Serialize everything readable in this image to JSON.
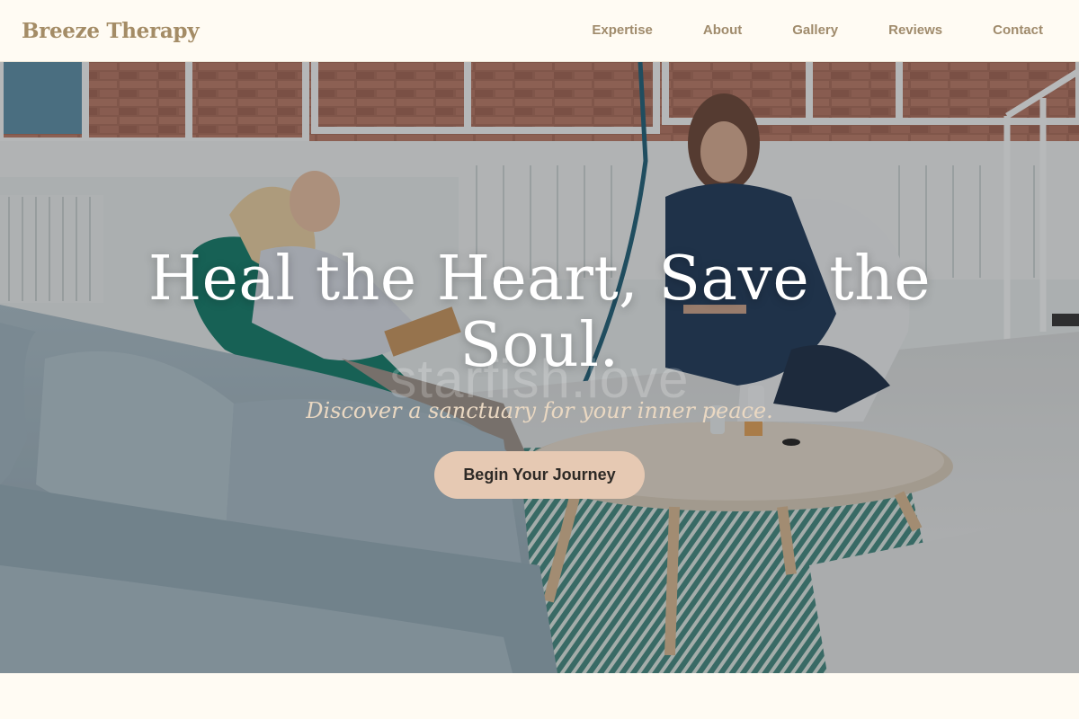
{
  "brand": {
    "name": "Breeze Therapy"
  },
  "nav": {
    "items": [
      {
        "label": "Expertise"
      },
      {
        "label": "About"
      },
      {
        "label": "Gallery"
      },
      {
        "label": "Reviews"
      },
      {
        "label": "Contact"
      }
    ]
  },
  "hero": {
    "headline": "Heal the Heart, Save the Soul.",
    "watermark": "starfish.love",
    "tagline": "Discover a sanctuary for your inner peace.",
    "cta_label": "Begin Your Journey"
  },
  "colors": {
    "background": "#fffbf3",
    "brand": "#a48c66",
    "nav_text": "#a08b6c",
    "cta_bg": "#e6c9b3",
    "tagline": "#ead8c2"
  }
}
